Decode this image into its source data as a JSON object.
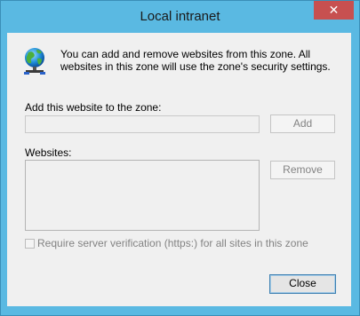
{
  "dialog": {
    "title": "Local intranet",
    "close_glyph": "✕",
    "info_text": "You can add and remove websites from this zone. All websites in this zone will use the zone's security settings.",
    "add_label": "Add this website to the zone:",
    "add_input_value": "",
    "add_button": "Add",
    "websites_label": "Websites:",
    "websites": [],
    "remove_button": "Remove",
    "require_verification_label": "Require server verification (https:) for all sites in this zone",
    "require_verification_checked": false,
    "close_button": "Close"
  },
  "icons": {
    "zone_icon": "globe-network-icon"
  },
  "colors": {
    "frame": "#5ab9e2",
    "close_x_bg": "#c75050",
    "client_bg": "#f0f0f0",
    "disabled_text": "#838383",
    "default_button_border": "#3c7fb1"
  }
}
